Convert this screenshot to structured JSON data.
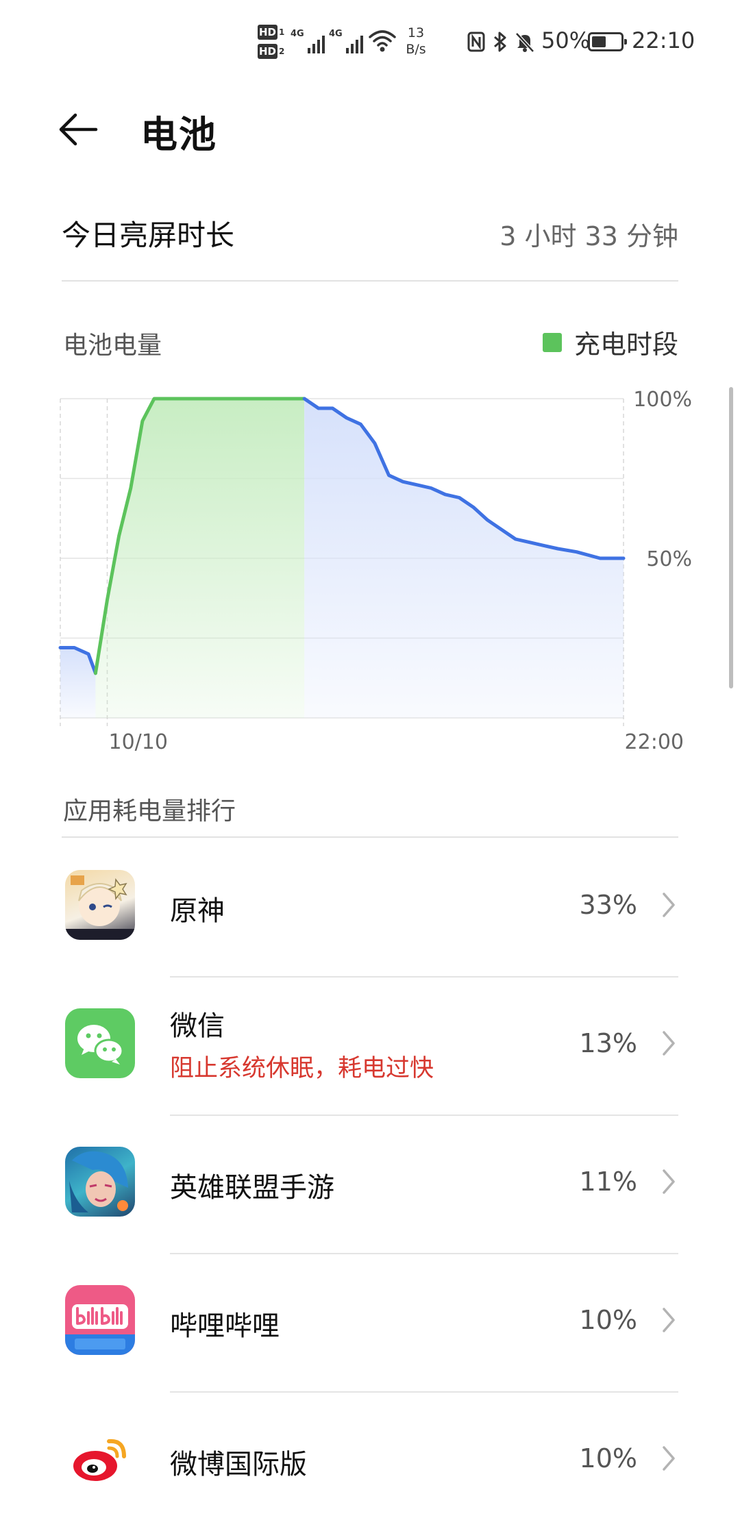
{
  "status_bar": {
    "hd1": "HD",
    "hd1_sub": "1",
    "hd2": "HD",
    "hd2_sub": "2",
    "net1": "4G",
    "net2": "4G",
    "speed_value": "13",
    "speed_unit": "B/s",
    "battery_percent": "50%",
    "battery_level": 0.5,
    "time": "22:10",
    "icons": [
      "nfc-icon",
      "bluetooth-icon",
      "mute-bell-icon"
    ]
  },
  "header": {
    "back_icon": "arrow-left-icon",
    "title": "电池"
  },
  "screen_time": {
    "label": "今日亮屏时长",
    "value": "3 小时 33 分钟"
  },
  "battery_chart": {
    "title": "电池电量",
    "legend_label": "充电时段",
    "colors": {
      "charging": "#5cc35c",
      "discharging": "#3f72e3",
      "charging_fill": "#c8edc3",
      "discharging_fill": "#d6e1fb"
    }
  },
  "chart_data": {
    "type": "area",
    "title": "电池电量",
    "xlabel": "",
    "ylabel": "",
    "x_tick_labels": [
      "10/10",
      "22:00"
    ],
    "y_tick_labels": [
      "100%",
      "50%"
    ],
    "ylim": [
      0,
      100
    ],
    "grid": true,
    "legend_position": "top-right",
    "x_note": "hours from chart start; 10/10 at 1, 22:00 at 12",
    "series": [
      {
        "name": "",
        "values": [
          [
            0.0,
            22
          ],
          [
            0.3,
            22
          ],
          [
            0.6,
            20
          ],
          [
            0.75,
            14
          ],
          [
            1.0,
            37
          ],
          [
            1.25,
            57
          ],
          [
            1.5,
            72
          ],
          [
            1.75,
            93
          ],
          [
            2.0,
            100
          ],
          [
            3.0,
            100
          ],
          [
            4.0,
            100
          ],
          [
            5.2,
            100
          ]
        ]
      },
      {
        "name": "",
        "values": [
          [
            5.2,
            100
          ],
          [
            5.5,
            97
          ],
          [
            5.8,
            97
          ],
          [
            6.1,
            94
          ],
          [
            6.4,
            92
          ],
          [
            6.7,
            86
          ],
          [
            7.0,
            76
          ],
          [
            7.3,
            74
          ],
          [
            7.6,
            73
          ],
          [
            7.9,
            72
          ],
          [
            8.2,
            70
          ],
          [
            8.5,
            69
          ],
          [
            8.8,
            66
          ],
          [
            9.1,
            62
          ],
          [
            9.4,
            59
          ],
          [
            9.7,
            56
          ],
          [
            10.0,
            55
          ],
          [
            10.3,
            54
          ],
          [
            10.6,
            53
          ],
          [
            11.0,
            52
          ],
          [
            11.5,
            50
          ],
          [
            12.0,
            50
          ]
        ]
      }
    ]
  },
  "ranking": {
    "title": "应用耗电量排行",
    "apps": [
      {
        "name": "原神",
        "percent": "33%",
        "warning": "",
        "icon": "genshin-app-icon"
      },
      {
        "name": "微信",
        "percent": "13%",
        "warning": "阻止系统休眠，耗电过快",
        "icon": "wechat-app-icon"
      },
      {
        "name": "英雄联盟手游",
        "percent": "11%",
        "warning": "",
        "icon": "lol-mobile-app-icon"
      },
      {
        "name": "哔哩哔哩",
        "percent": "10%",
        "warning": "",
        "icon": "bilibili-app-icon"
      },
      {
        "name": "微博国际版",
        "percent": "10%",
        "warning": "",
        "icon": "weibo-intl-app-icon"
      }
    ]
  }
}
